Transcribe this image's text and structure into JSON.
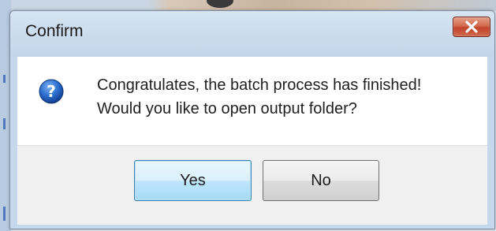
{
  "dialog": {
    "title": "Confirm",
    "message_line1": "Congratulates, the batch process has finished!",
    "message_line2": "Would you like to open output folder?",
    "icon": "question-icon",
    "buttons": {
      "yes_label": "Yes",
      "no_label": "No"
    },
    "close_icon": "close-icon"
  },
  "colors": {
    "titlebar": "#c6d9ec",
    "close_button": "#c1432a",
    "default_button_border": "#3c7fb1",
    "icon_blue": "#1f5fbf"
  }
}
